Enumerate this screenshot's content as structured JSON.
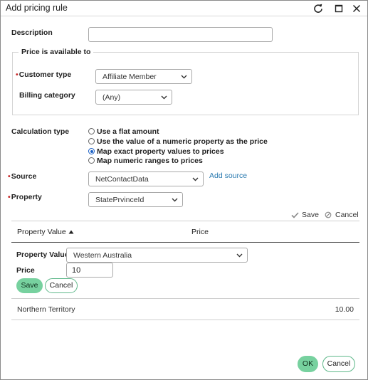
{
  "window": {
    "title": "Add pricing rule"
  },
  "form": {
    "description_label": "Description",
    "description_value": "",
    "price_available_legend": "Price is available to",
    "customer_type_label": "Customer type",
    "customer_type_value": "Affiliate Member",
    "billing_category_label": "Billing category",
    "billing_category_value": "(Any)",
    "calculation_type_label": "Calculation type",
    "calculation_options": [
      {
        "label": "Use a flat amount",
        "selected": false
      },
      {
        "label": "Use the value of a numeric property as the price",
        "selected": false
      },
      {
        "label": "Map exact property values to prices",
        "selected": true
      },
      {
        "label": "Map numeric ranges to prices",
        "selected": false
      }
    ],
    "source_label": "Source",
    "source_value": "NetContactData",
    "add_source_link": "Add source",
    "property_label": "Property",
    "property_value": "StatePrvinceId"
  },
  "grid_actions": {
    "save": "Save",
    "cancel": "Cancel"
  },
  "grid": {
    "col_property_value": "Property Value",
    "col_price": "Price",
    "edit_row": {
      "property_value_label": "Property Value",
      "property_value": "Western Australia",
      "price_label": "Price",
      "price_value": "10",
      "save_label": "Save",
      "cancel_label": "Cancel"
    },
    "rows": [
      {
        "property_value": "Northern Territory",
        "price": "10.00"
      }
    ]
  },
  "footer": {
    "ok_label": "OK",
    "cancel_label": "Cancel"
  },
  "colors": {
    "accent_green": "#77d19f",
    "required_red": "#c62828",
    "link_blue": "#2a7ab0",
    "radio_blue": "#1a5fc4"
  }
}
